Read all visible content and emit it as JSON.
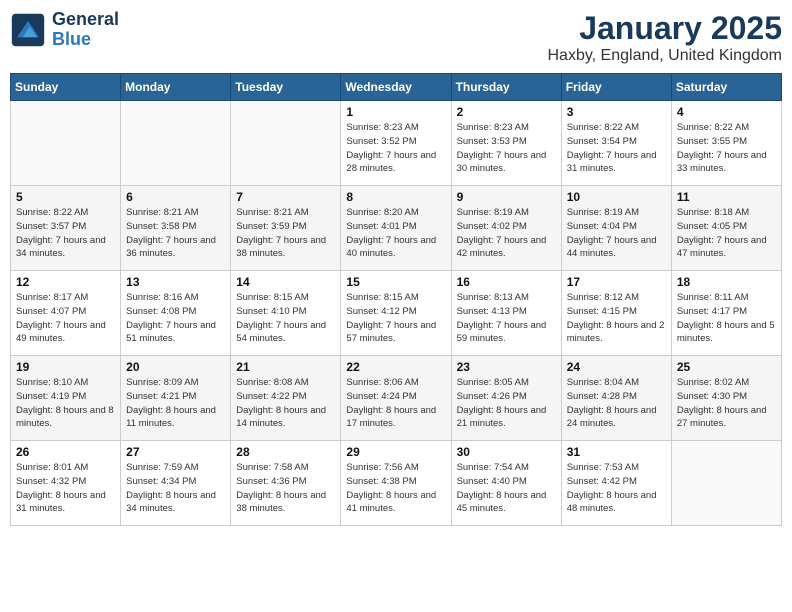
{
  "logo": {
    "line1": "General",
    "line2": "Blue"
  },
  "title": "January 2025",
  "location": "Haxby, England, United Kingdom",
  "weekdays": [
    "Sunday",
    "Monday",
    "Tuesday",
    "Wednesday",
    "Thursday",
    "Friday",
    "Saturday"
  ],
  "weeks": [
    [
      {
        "day": "",
        "empty": true
      },
      {
        "day": "",
        "empty": true
      },
      {
        "day": "",
        "empty": true
      },
      {
        "day": "1",
        "sunrise": "8:23 AM",
        "sunset": "3:52 PM",
        "daylight": "7 hours and 28 minutes."
      },
      {
        "day": "2",
        "sunrise": "8:23 AM",
        "sunset": "3:53 PM",
        "daylight": "7 hours and 30 minutes."
      },
      {
        "day": "3",
        "sunrise": "8:22 AM",
        "sunset": "3:54 PM",
        "daylight": "7 hours and 31 minutes."
      },
      {
        "day": "4",
        "sunrise": "8:22 AM",
        "sunset": "3:55 PM",
        "daylight": "7 hours and 33 minutes."
      }
    ],
    [
      {
        "day": "5",
        "sunrise": "8:22 AM",
        "sunset": "3:57 PM",
        "daylight": "7 hours and 34 minutes."
      },
      {
        "day": "6",
        "sunrise": "8:21 AM",
        "sunset": "3:58 PM",
        "daylight": "7 hours and 36 minutes."
      },
      {
        "day": "7",
        "sunrise": "8:21 AM",
        "sunset": "3:59 PM",
        "daylight": "7 hours and 38 minutes."
      },
      {
        "day": "8",
        "sunrise": "8:20 AM",
        "sunset": "4:01 PM",
        "daylight": "7 hours and 40 minutes."
      },
      {
        "day": "9",
        "sunrise": "8:19 AM",
        "sunset": "4:02 PM",
        "daylight": "7 hours and 42 minutes."
      },
      {
        "day": "10",
        "sunrise": "8:19 AM",
        "sunset": "4:04 PM",
        "daylight": "7 hours and 44 minutes."
      },
      {
        "day": "11",
        "sunrise": "8:18 AM",
        "sunset": "4:05 PM",
        "daylight": "7 hours and 47 minutes."
      }
    ],
    [
      {
        "day": "12",
        "sunrise": "8:17 AM",
        "sunset": "4:07 PM",
        "daylight": "7 hours and 49 minutes."
      },
      {
        "day": "13",
        "sunrise": "8:16 AM",
        "sunset": "4:08 PM",
        "daylight": "7 hours and 51 minutes."
      },
      {
        "day": "14",
        "sunrise": "8:15 AM",
        "sunset": "4:10 PM",
        "daylight": "7 hours and 54 minutes."
      },
      {
        "day": "15",
        "sunrise": "8:15 AM",
        "sunset": "4:12 PM",
        "daylight": "7 hours and 57 minutes."
      },
      {
        "day": "16",
        "sunrise": "8:13 AM",
        "sunset": "4:13 PM",
        "daylight": "7 hours and 59 minutes."
      },
      {
        "day": "17",
        "sunrise": "8:12 AM",
        "sunset": "4:15 PM",
        "daylight": "8 hours and 2 minutes."
      },
      {
        "day": "18",
        "sunrise": "8:11 AM",
        "sunset": "4:17 PM",
        "daylight": "8 hours and 5 minutes."
      }
    ],
    [
      {
        "day": "19",
        "sunrise": "8:10 AM",
        "sunset": "4:19 PM",
        "daylight": "8 hours and 8 minutes."
      },
      {
        "day": "20",
        "sunrise": "8:09 AM",
        "sunset": "4:21 PM",
        "daylight": "8 hours and 11 minutes."
      },
      {
        "day": "21",
        "sunrise": "8:08 AM",
        "sunset": "4:22 PM",
        "daylight": "8 hours and 14 minutes."
      },
      {
        "day": "22",
        "sunrise": "8:06 AM",
        "sunset": "4:24 PM",
        "daylight": "8 hours and 17 minutes."
      },
      {
        "day": "23",
        "sunrise": "8:05 AM",
        "sunset": "4:26 PM",
        "daylight": "8 hours and 21 minutes."
      },
      {
        "day": "24",
        "sunrise": "8:04 AM",
        "sunset": "4:28 PM",
        "daylight": "8 hours and 24 minutes."
      },
      {
        "day": "25",
        "sunrise": "8:02 AM",
        "sunset": "4:30 PM",
        "daylight": "8 hours and 27 minutes."
      }
    ],
    [
      {
        "day": "26",
        "sunrise": "8:01 AM",
        "sunset": "4:32 PM",
        "daylight": "8 hours and 31 minutes."
      },
      {
        "day": "27",
        "sunrise": "7:59 AM",
        "sunset": "4:34 PM",
        "daylight": "8 hours and 34 minutes."
      },
      {
        "day": "28",
        "sunrise": "7:58 AM",
        "sunset": "4:36 PM",
        "daylight": "8 hours and 38 minutes."
      },
      {
        "day": "29",
        "sunrise": "7:56 AM",
        "sunset": "4:38 PM",
        "daylight": "8 hours and 41 minutes."
      },
      {
        "day": "30",
        "sunrise": "7:54 AM",
        "sunset": "4:40 PM",
        "daylight": "8 hours and 45 minutes."
      },
      {
        "day": "31",
        "sunrise": "7:53 AM",
        "sunset": "4:42 PM",
        "daylight": "8 hours and 48 minutes."
      },
      {
        "day": "",
        "empty": true
      }
    ]
  ]
}
